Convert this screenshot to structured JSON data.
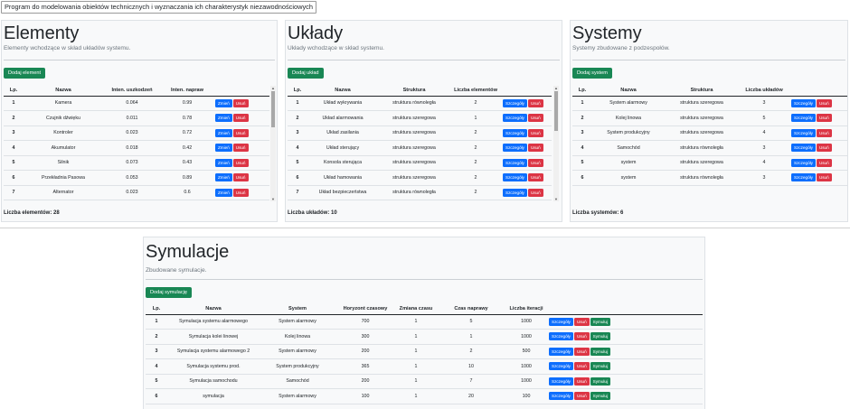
{
  "app": {
    "title": "Program do modelowania obiektów technicznych i wyznaczania ich charakterystyk niezawodnościowych"
  },
  "elements": {
    "title": "Elementy",
    "subtitle": "Elementy wchodzące w skład układów systemu.",
    "add_label": "Dodaj element",
    "headers": [
      "Lp.",
      "Nazwa",
      "Inten. uszkodzeń",
      "Inten. napraw"
    ],
    "rows": [
      [
        "1",
        "Kamera",
        "0.064",
        "0.99"
      ],
      [
        "2",
        "Czujnik dźwięku",
        "0.011",
        "0.78"
      ],
      [
        "3",
        "Kontroler",
        "0.023",
        "0.72"
      ],
      [
        "4",
        "Akumulator",
        "0.018",
        "0.42"
      ],
      [
        "5",
        "Silnik",
        "0.073",
        "0.43"
      ],
      [
        "6",
        "Przekładnia Pasowa",
        "0.053",
        "0.89"
      ],
      [
        "7",
        "Alternator",
        "0.023",
        "0.6"
      ]
    ],
    "count_label": "Liczba elementów: 28"
  },
  "uklady": {
    "title": "Układy",
    "subtitle": "Układy wchodzące w skład systemu.",
    "add_label": "Dodaj układ",
    "headers": [
      "Lp.",
      "Nazwa",
      "Struktura",
      "Liczba elementów"
    ],
    "rows": [
      [
        "1",
        "Układ wykrywania",
        "struktura równoległa",
        "2"
      ],
      [
        "2",
        "Układ alarmowania",
        "struktura szeregowa",
        "1"
      ],
      [
        "3",
        "Układ zasilania",
        "struktura szeregowa",
        "2"
      ],
      [
        "4",
        "Układ sterujący",
        "struktura szeregowa",
        "2"
      ],
      [
        "5",
        "Konsola sterująca",
        "struktura szeregowa",
        "2"
      ],
      [
        "6",
        "Układ hamowania",
        "struktura szeregowa",
        "2"
      ],
      [
        "7",
        "Układ bezpieczeństwa",
        "struktura równoległa",
        "2"
      ]
    ],
    "count_label": "Liczba układów: 10"
  },
  "systemy": {
    "title": "Systemy",
    "subtitle": "Systemy zbudowane z podzespołów.",
    "add_label": "Dodaj system",
    "headers": [
      "Lp.",
      "Nazwa",
      "Struktura",
      "Liczba układów"
    ],
    "rows": [
      [
        "1",
        "System alarmowy",
        "struktura szeregowa",
        "3"
      ],
      [
        "2",
        "Kolej linowa",
        "struktura szeregowa",
        "5"
      ],
      [
        "3",
        "System produkcyjny",
        "struktura szeregowa",
        "4"
      ],
      [
        "4",
        "Samochód",
        "struktura równoległa",
        "3"
      ],
      [
        "5",
        "system",
        "struktura szeregowa",
        "4"
      ],
      [
        "6",
        "system",
        "struktura równoległa",
        "3"
      ]
    ],
    "count_label": "Liczba systemów: 6"
  },
  "symulacje": {
    "title": "Symulacje",
    "subtitle": "Zbudowane symulacje.",
    "add_label": "Dodaj symulację",
    "headers": [
      "Lp.",
      "Nazwa",
      "System",
      "Horyzont czasowy",
      "Zmiana czasu",
      "Czas naprawy",
      "Liczba iteracji"
    ],
    "rows": [
      [
        "1",
        "Symulacja systemu alarmowego",
        "System alarmowy",
        "700",
        "1",
        "5",
        "1000"
      ],
      [
        "2",
        "Symulacja kolei linowej",
        "Kolej linowa",
        "300",
        "1",
        "1",
        "1000"
      ],
      [
        "3",
        "Symulacja systemu alarmowego 2",
        "System alarmowy",
        "200",
        "1",
        "2",
        "500"
      ],
      [
        "4",
        "Symulacja systemu prod.",
        "System produkcyjny",
        "365",
        "1",
        "10",
        "1000"
      ],
      [
        "5",
        "Symulacja samochodu",
        "Samochód",
        "200",
        "1",
        "7",
        "1000"
      ],
      [
        "6",
        "symulacja",
        "System alarmowy",
        "100",
        "1",
        "20",
        "100"
      ]
    ]
  },
  "actions": {
    "details": "Szczegóły",
    "delete": "Usuń",
    "simulate": "Symuluj",
    "edit": "Zmień"
  },
  "colors": {
    "primary": "#0d6efd",
    "danger": "#dc3545",
    "success": "#198754"
  }
}
